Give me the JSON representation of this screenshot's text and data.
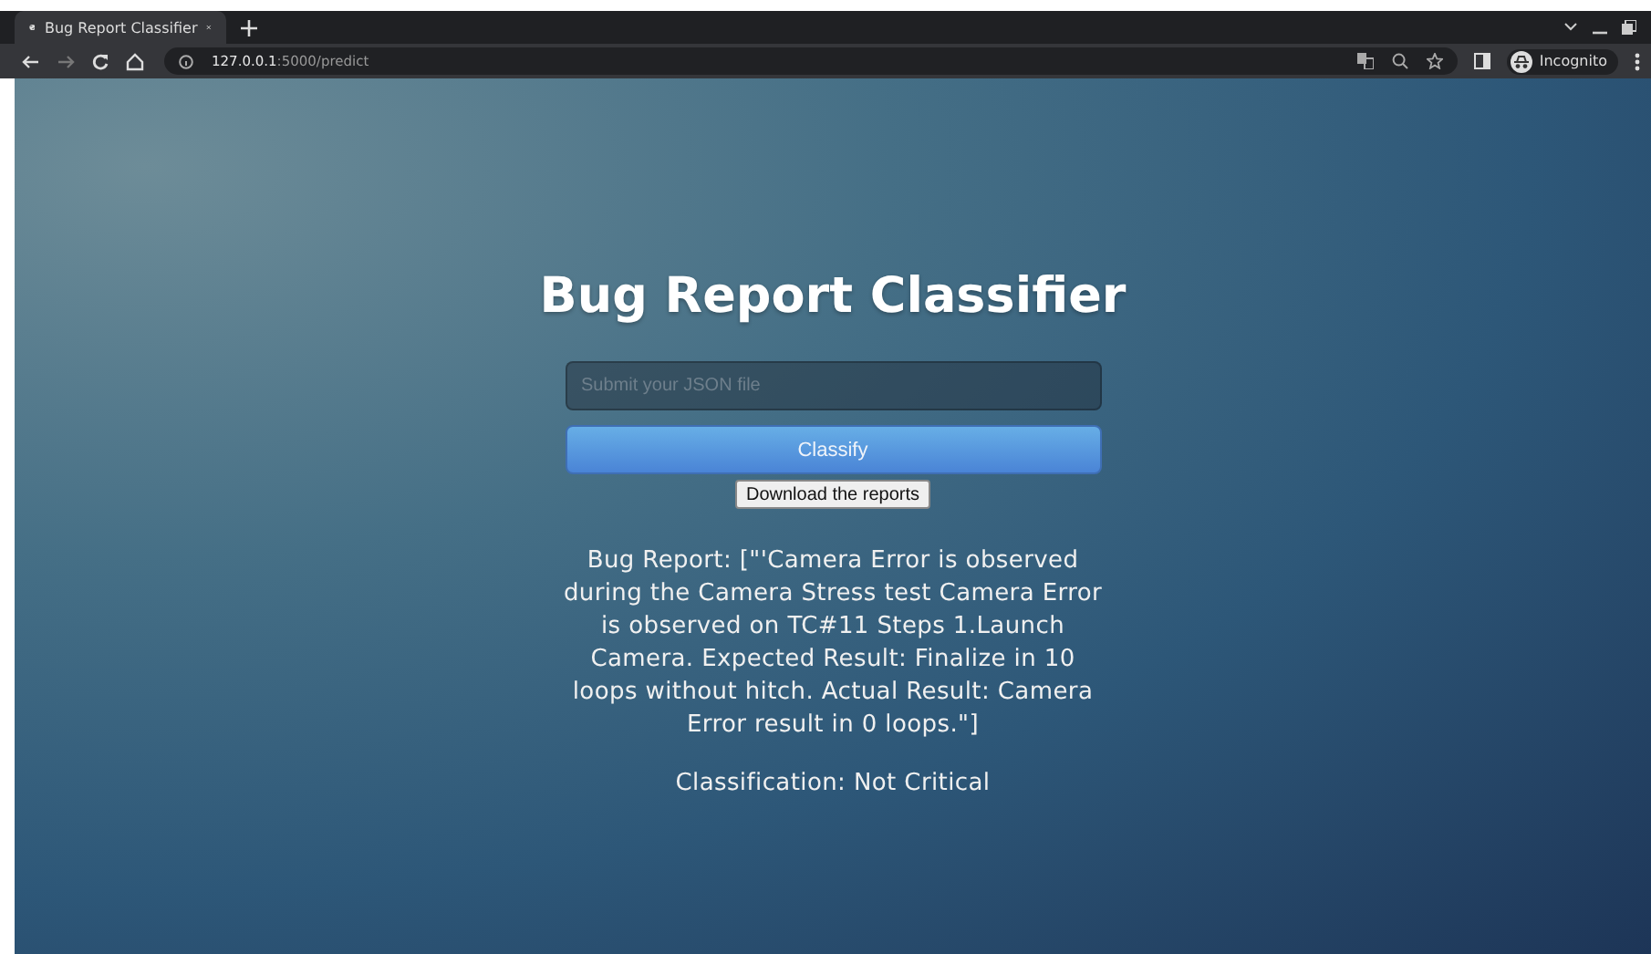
{
  "browser": {
    "tab": {
      "title": "Bug Report Classifier",
      "selected": true
    },
    "url_host": "127.0.0.1",
    "url_path": ":5000/predict",
    "profile": "Incognito"
  },
  "page": {
    "title": "Bug Report Classifier",
    "file_field": {
      "placeholder": "Submit your JSON file"
    },
    "classify_button": "Classify",
    "download_button": "Download the reports",
    "report": "Bug Report: [\"'Camera Error is observed during the Camera Stress test Camera Error is observed on TC#11 Steps 1.Launch Camera. Expected Result: Finalize in 10 loops without hitch. Actual Result: Camera Error result in 0 loops.\"]",
    "classification": "Classification: Not Critical"
  }
}
